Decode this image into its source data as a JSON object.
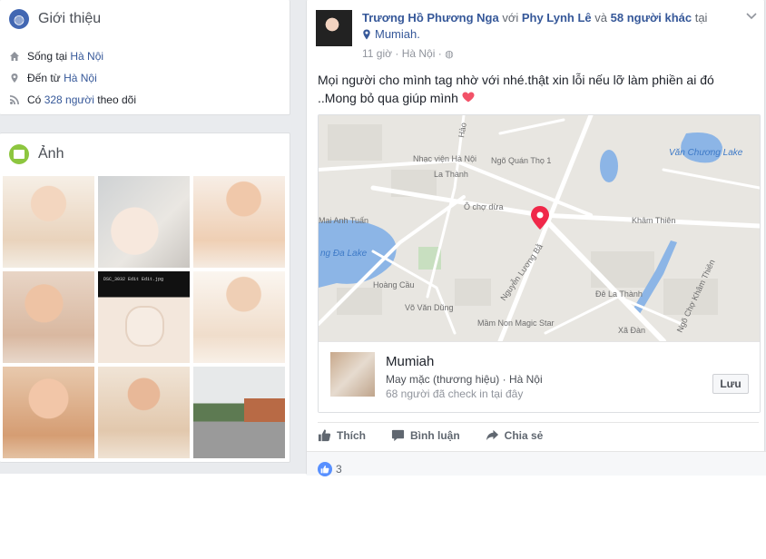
{
  "intro": {
    "title": "Giới thiệu",
    "lives_prefix": "Sống tại ",
    "lives_city": "Hà Nội",
    "from_prefix": "Đến từ ",
    "from_city": "Hà Nội",
    "followers_prefix": "Có ",
    "followers_link": "328 người",
    "followers_suffix": " theo dõi"
  },
  "photos": {
    "title": "Ảnh",
    "thumbnail_caption": "DSC_3032 Edit Edit.jpg"
  },
  "post": {
    "author": "Trương Hồ Phương Nga",
    "with_text": " với ",
    "tagged": "Phy Lynh Lê",
    "and_text": " và ",
    "others": "58 người khác",
    "at_text": " tại",
    "location": "Mumiah.",
    "time": "11 giờ",
    "time_city": "Hà Nội",
    "separator": "·",
    "text": "Mọi người cho mình tag nhờ với nhé.thật xin lỗi nếu lỡ làm phiền ai đó ..Mong bỏ qua giúp mình",
    "map_labels": {
      "van_chuong": "Văn Chương Lake",
      "nhac_vien": "Nhạc viện Hà Nội",
      "ngo_quan_tho": "Ngõ Quán Thọ 1",
      "la_thanh": "La Thành",
      "o_cho_dua": "Ô chợ dừa",
      "kham_thien": "Khâm Thiên",
      "mai_anh_tuan": "Mai Anh Tuấn",
      "dong_da_lake": "ng Đa Lake",
      "hoang_cau": "Hoàng Cầu",
      "vo_van_dung": "Võ Văn Dũng",
      "nguyen_luong_bang": "Nguyễn Lương Bằ",
      "de_la_thanh": "Đê La Thành",
      "xa_dan": "Xã Đàn",
      "mam_non": "Mầm Non Magic Star",
      "ngo_cho_kham_thien": "Ngõ Chợ Khâm Thiên",
      "hao_nam": "Hào"
    },
    "place": {
      "name": "Mumiah",
      "category": "May mặc (thương hiệu) · Hà Nội",
      "checkins": "68 người đã check in tại đây",
      "save_label": "Lưu"
    },
    "actions": {
      "like": "Thích",
      "comment": "Bình luận",
      "share": "Chia sẻ"
    },
    "reaction_count": "3"
  },
  "colors": {
    "link": "#365899",
    "background": "#e9ebee",
    "accent_blue": "#4267b2",
    "pin": "#f02849"
  }
}
